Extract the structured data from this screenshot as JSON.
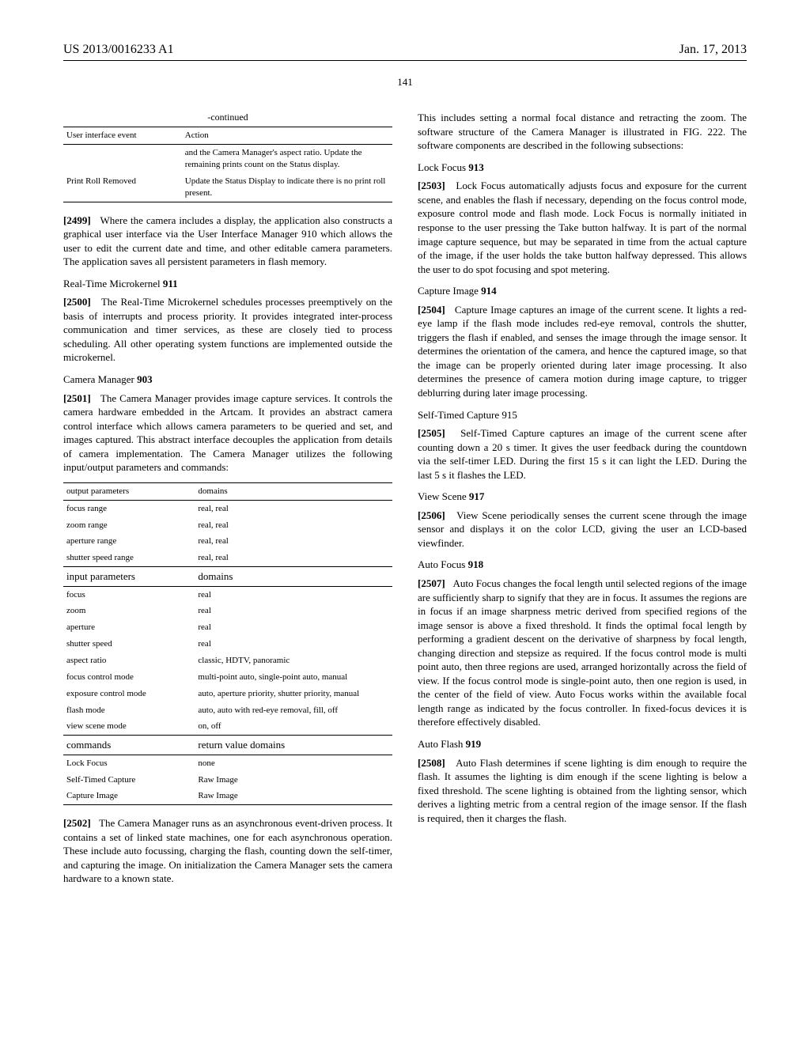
{
  "header": {
    "left": "US 2013/0016233 A1",
    "right": "Jan. 17, 2013"
  },
  "page_number": "141",
  "left_col": {
    "table1": {
      "caption": "-continued",
      "head_c1": "User interface event",
      "head_c2": "Action",
      "row1_c1": "",
      "row1_c2": "and the Camera Manager's aspect ratio. Update the remaining prints count on the Status display.",
      "row2_c1": "Print Roll Removed",
      "row2_c2": "Update the Status Display to indicate there is no print roll present."
    },
    "p2499": {
      "num": "[2499]",
      "text": "Where the camera includes a display, the application also constructs a graphical user interface via the User Interface Manager 910 which allows the user to edit the current date and time, and other editable camera parameters. The application saves all persistent parameters in flash memory."
    },
    "sec_rtk": {
      "title": "Real-Time Microkernel",
      "num": "911"
    },
    "p2500": {
      "num": "[2500]",
      "text": "The Real-Time Microkernel schedules processes preemptively on the basis of interrupts and process priority. It provides integrated inter-process communication and timer services, as these are closely tied to process scheduling. All other operating system functions are implemented outside the microkernel."
    },
    "sec_cm": {
      "title": "Camera Manager",
      "num": "903"
    },
    "p2501": {
      "num": "[2501]",
      "text": "The Camera Manager provides image capture services. It controls the camera hardware embedded in the Artcam. It provides an abstract camera control interface which allows camera parameters to be queried and set, and images captured. This abstract interface decouples the application from details of camera implementation. The Camera Manager utilizes the following input/output parameters and commands:"
    },
    "table2": {
      "h1_c1": "output parameters",
      "h1_c2": "domains",
      "out_rows": [
        {
          "c1": "focus range",
          "c2": "real, real"
        },
        {
          "c1": "zoom range",
          "c2": "real, real"
        },
        {
          "c1": "aperture range",
          "c2": "real, real"
        },
        {
          "c1": "shutter speed range",
          "c2": "real, real"
        }
      ],
      "h2_c1": "input parameters",
      "h2_c2": "domains",
      "in_rows": [
        {
          "c1": "focus",
          "c2": "real"
        },
        {
          "c1": "zoom",
          "c2": "real"
        },
        {
          "c1": "aperture",
          "c2": "real"
        },
        {
          "c1": "shutter speed",
          "c2": "real"
        },
        {
          "c1": "aspect ratio",
          "c2": "classic, HDTV, panoramic"
        },
        {
          "c1": "focus control mode",
          "c2": "multi-point auto, single-point auto, manual"
        },
        {
          "c1": "exposure control mode",
          "c2": "auto, aperture priority, shutter priority, manual"
        },
        {
          "c1": "flash mode",
          "c2": "auto, auto with red-eye removal, fill, off"
        },
        {
          "c1": "view scene mode",
          "c2": "on, off"
        }
      ],
      "h3_c1": "commands",
      "h3_c2": "return value domains",
      "cmd_rows": [
        {
          "c1": "Lock Focus",
          "c2": "none"
        },
        {
          "c1": "Self-Timed Capture",
          "c2": "Raw Image"
        },
        {
          "c1": "Capture Image",
          "c2": "Raw Image"
        }
      ]
    },
    "p2502": {
      "num": "[2502]",
      "text": "The Camera Manager runs as an asynchronous event-driven process. It contains a set of linked state machines, one for each asynchronous operation. These include auto focussing, charging the flash, counting down the self-timer, and capturing the image. On initialization the Camera Manager sets the camera hardware to a known state."
    }
  },
  "right_col": {
    "intro": "This includes setting a normal focal distance and retracting the zoom. The software structure of the Camera Manager is illustrated in FIG. 222. The software components are described in the following subsections:",
    "sec_lf": {
      "title": "Lock Focus",
      "num": "913"
    },
    "p2503": {
      "num": "[2503]",
      "text": "Lock Focus automatically adjusts focus and exposure for the current scene, and enables the flash if necessary, depending on the focus control mode, exposure control mode and flash mode. Lock Focus is normally initiated in response to the user pressing the Take button halfway. It is part of the normal image capture sequence, but may be separated in time from the actual capture of the image, if the user holds the take button halfway depressed. This allows the user to do spot focusing and spot metering."
    },
    "sec_ci": {
      "title": "Capture Image",
      "num": "914"
    },
    "p2504": {
      "num": "[2504]",
      "text": "Capture Image captures an image of the current scene. It lights a red-eye lamp if the flash mode includes red-eye removal, controls the shutter, triggers the flash if enabled, and senses the image through the image sensor. It determines the orientation of the camera, and hence the captured image, so that the image can be properly oriented during later image processing. It also determines the presence of camera motion during image capture, to trigger deblurring during later image processing."
    },
    "sec_stc": {
      "title": "Self-Timed Capture",
      "num": "915"
    },
    "p2505": {
      "num": "[2505]",
      "text": "Self-Timed Capture captures an image of the current scene after counting down a 20 s timer. It gives the user feedback during the countdown via the self-timer LED. During the first 15 s it can light the LED. During the last 5 s it flashes the LED."
    },
    "sec_vs": {
      "title": "View Scene",
      "num": "917"
    },
    "p2506": {
      "num": "[2506]",
      "text": "View Scene periodically senses the current scene through the image sensor and displays it on the color LCD, giving the user an LCD-based viewfinder."
    },
    "sec_af": {
      "title": "Auto Focus",
      "num": "918"
    },
    "p2507": {
      "num": "[2507]",
      "text": "Auto Focus changes the focal length until selected regions of the image are sufficiently sharp to signify that they are in focus. It assumes the regions are in focus if an image sharpness metric derived from specified regions of the image sensor is above a fixed threshold. It finds the optimal focal length by performing a gradient descent on the derivative of sharpness by focal length, changing direction and stepsize as required. If the focus control mode is multi point auto, then three regions are used, arranged horizontally across the field of view. If the focus control mode is single-point auto, then one region is used, in the center of the field of view. Auto Focus works within the available focal length range as indicated by the focus controller. In fixed-focus devices it is therefore effectively disabled."
    },
    "sec_afl": {
      "title": "Auto Flash",
      "num": "919"
    },
    "p2508": {
      "num": "[2508]",
      "text": "Auto Flash determines if scene lighting is dim enough to require the flash. It assumes the lighting is dim enough if the scene lighting is below a fixed threshold. The scene lighting is obtained from the lighting sensor, which derives a lighting metric from a central region of the image sensor. If the flash is required, then it charges the flash."
    }
  }
}
